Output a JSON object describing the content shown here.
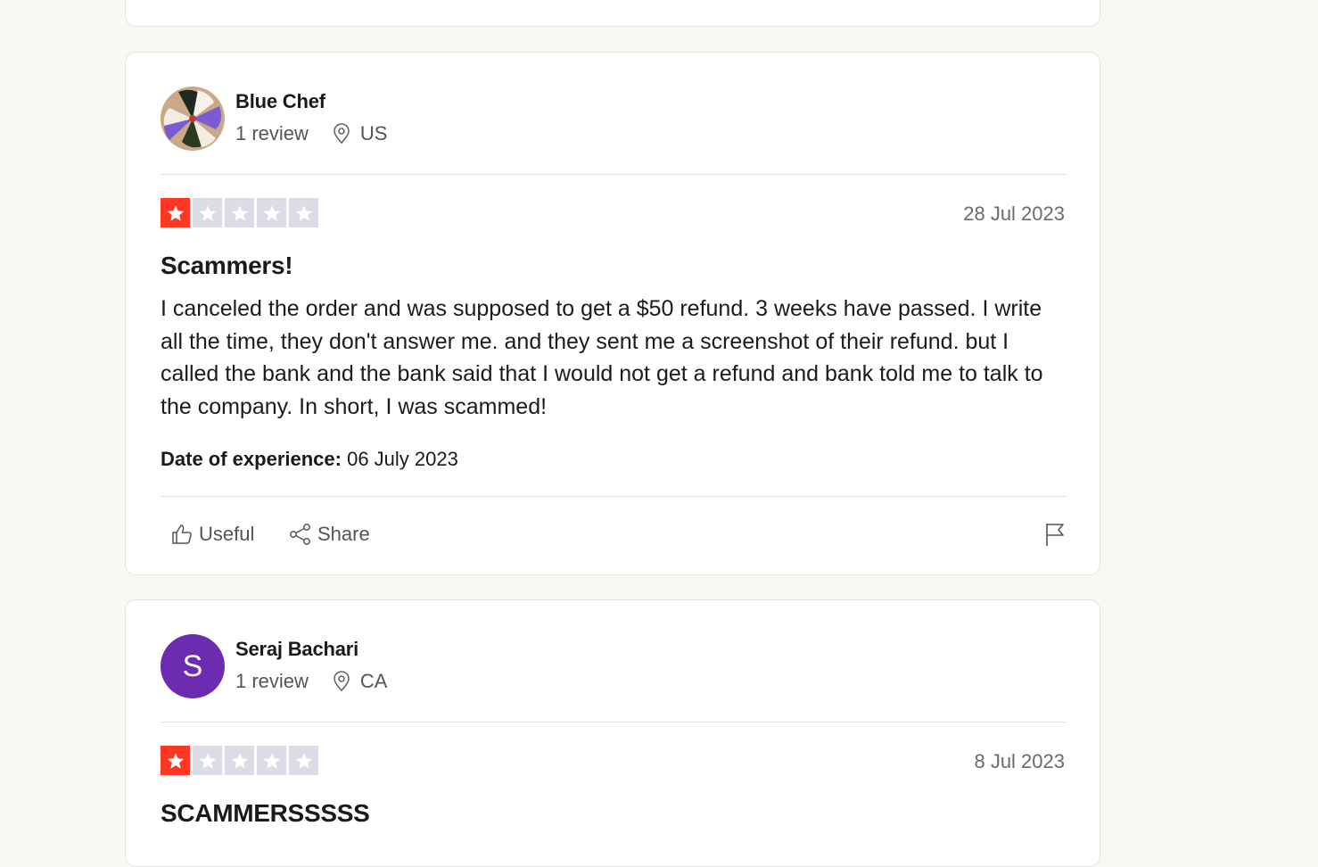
{
  "reviews": [
    {
      "reviewer_name": "Blue Chef",
      "review_count": "1 review",
      "country": "US",
      "avatar_icon": "floral-pattern-avatar",
      "rating": 1,
      "date": "28 Jul 2023",
      "title": "Scammers!",
      "body": "I canceled the order and was supposed to get a $50 refund. 3 weeks have passed. I write all the time, they don't answer me. and they sent me a screenshot of their refund. but I called the bank and the bank said that I would not get a refund and bank told me to talk to the company. In short, I was scammed!",
      "experience_label": "Date of experience:",
      "experience_date": "06 July 2023",
      "useful_label": "Useful",
      "share_label": "Share"
    },
    {
      "reviewer_name": "Seraj Bachari",
      "review_count": "1 review",
      "country": "CA",
      "avatar_letter": "S",
      "avatar_color": "#6c2bb0",
      "rating": 1,
      "date": "8 Jul 2023",
      "title": "SCAMMERSSSSS"
    }
  ],
  "colors": {
    "star_active": "#ff3722",
    "star_inactive": "#dcdce6",
    "page_background": "#f9f8f4"
  }
}
